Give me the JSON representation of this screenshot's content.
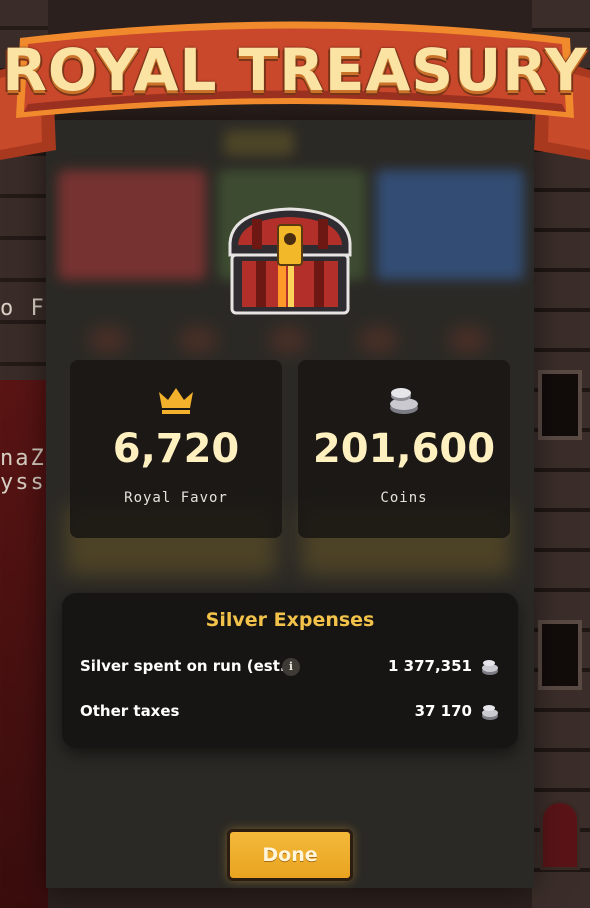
{
  "banner": {
    "title": "ROYAL TREASURY"
  },
  "stats": {
    "favor": {
      "value": "6,720",
      "label": "Royal Favor",
      "icon": "crown-icon"
    },
    "coins": {
      "value": "201,600",
      "label": "Coins",
      "icon": "silver-coins-icon"
    }
  },
  "expenses": {
    "title": "Silver Expenses",
    "rows": [
      {
        "label": "Silver spent on run (est.)",
        "value": "1 377,351",
        "has_info": true
      },
      {
        "label": "Other taxes",
        "value": "37 170",
        "has_info": false
      }
    ],
    "info_glyph": "i"
  },
  "background": {
    "left_text_1": "o F",
    "left_text_2": "naZ",
    "left_text_3": "yss"
  },
  "done_button": {
    "label": "Done"
  },
  "colors": {
    "accent_gold": "#f3c24a",
    "button": "#f4b93a",
    "banner_red": "#c4472c",
    "panel": "#2b2925"
  }
}
